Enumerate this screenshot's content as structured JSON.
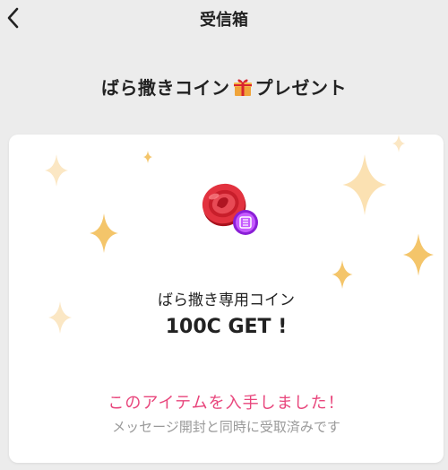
{
  "header": {
    "title": "受信箱",
    "back_icon": "chevron-left-icon"
  },
  "message": {
    "title_prefix": "ばら撒きコイン",
    "title_icon": "gift-icon",
    "title_suffix": "プレゼント"
  },
  "item": {
    "icon": "coin-icon",
    "name": "ばら撒き専用コイン",
    "amount": "100C GET !",
    "obtained_text": "このアイテムを入手しました！",
    "received_text": "メッセージ開封と同時に受取済みです"
  },
  "colors": {
    "background": "#ececec",
    "card": "#ffffff",
    "accent_pink": "#e8467c",
    "muted_text": "#9a9a9a",
    "sparkle": "#f7d58a"
  }
}
